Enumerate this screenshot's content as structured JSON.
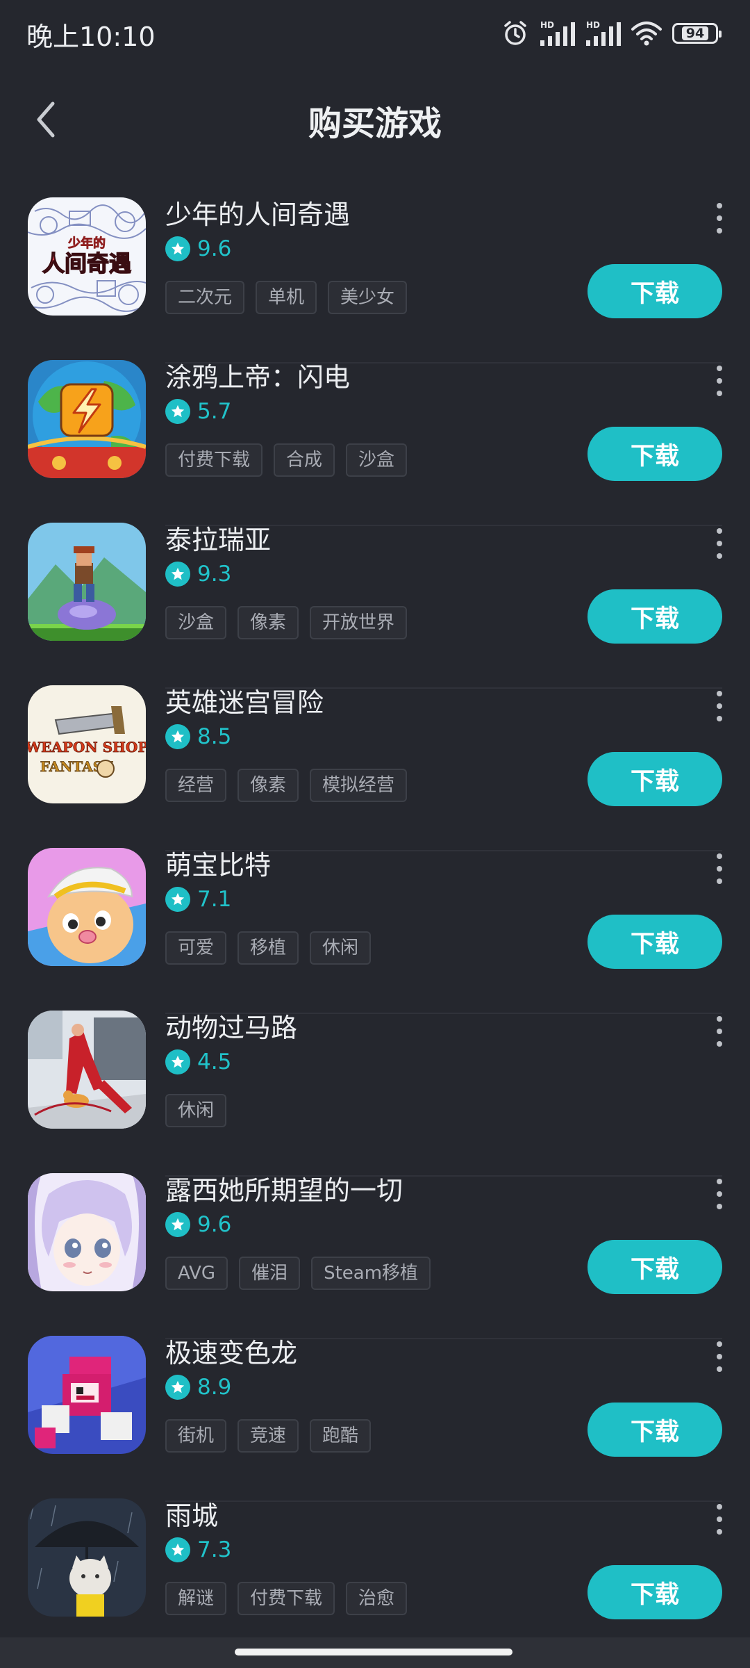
{
  "status_bar": {
    "time": "晚上10:10",
    "battery": "94",
    "icons": [
      "alarm-icon",
      "hd-signal-icon",
      "hd-signal-icon",
      "wifi-icon",
      "battery-icon"
    ]
  },
  "header": {
    "title": "购买游戏",
    "back_icon": "chevron-left-icon"
  },
  "colors": {
    "background": "#25272e",
    "accent": "#1fbfc6",
    "divider": "#30323a",
    "tag_text": "#a9acb4"
  },
  "download_label": "下载",
  "games": [
    {
      "name": "少年的人间奇遇",
      "rating": "9.6",
      "tags": [
        "二次元",
        "单机",
        "美少女"
      ],
      "has_download": true,
      "icon_text": "人间奇遇",
      "icon_subtext": "少年的"
    },
    {
      "name": "涂鸦上帝：闪电",
      "rating": "5.7",
      "tags": [
        "付费下载",
        "合成",
        "沙盒"
      ],
      "has_download": true
    },
    {
      "name": "泰拉瑞亚",
      "rating": "9.3",
      "tags": [
        "沙盒",
        "像素",
        "开放世界"
      ],
      "has_download": true
    },
    {
      "name": "英雄迷宫冒险",
      "rating": "8.5",
      "tags": [
        "经营",
        "像素",
        "模拟经营"
      ],
      "has_download": true,
      "icon_text": "WEAPON SHOP",
      "icon_subtext": "FANTASY"
    },
    {
      "name": "萌宝比特",
      "rating": "7.1",
      "tags": [
        "可爱",
        "移植",
        "休闲"
      ],
      "has_download": true
    },
    {
      "name": "动物过马路",
      "rating": "4.5",
      "tags": [
        "休闲"
      ],
      "has_download": false
    },
    {
      "name": "露西她所期望的一切",
      "rating": "9.6",
      "tags": [
        "AVG",
        "催泪",
        "Steam移植"
      ],
      "has_download": true
    },
    {
      "name": "极速变色龙",
      "rating": "8.9",
      "tags": [
        "街机",
        "竞速",
        "跑酷"
      ],
      "has_download": true
    },
    {
      "name": "雨城",
      "rating": "7.3",
      "tags": [
        "解谜",
        "付费下载",
        "治愈"
      ],
      "has_download": true
    }
  ]
}
